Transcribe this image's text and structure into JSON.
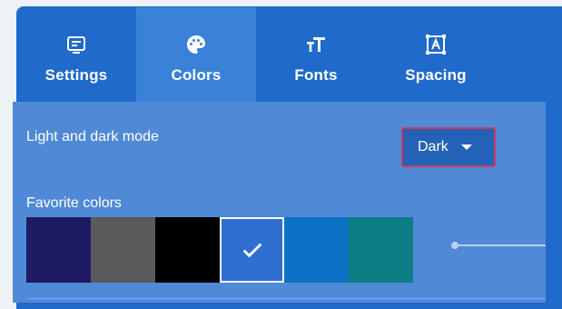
{
  "tabs": [
    {
      "label": "Settings",
      "icon": "settings-icon",
      "active": false
    },
    {
      "label": "Colors",
      "icon": "palette-icon",
      "active": true
    },
    {
      "label": "Fonts",
      "icon": "text-size-icon",
      "active": false
    },
    {
      "label": "Spacing",
      "icon": "spacing-icon",
      "active": false
    }
  ],
  "mode": {
    "label": "Light and dark mode",
    "value": "Dark"
  },
  "favorites": {
    "label": "Favorite colors",
    "swatches": [
      {
        "color": "#1c1b63",
        "selected": false
      },
      {
        "color": "#5a5a5a",
        "selected": false
      },
      {
        "color": "#000000",
        "selected": false
      },
      {
        "color": "#2f6fd2",
        "selected": true
      },
      {
        "color": "#0b73c3",
        "selected": false
      },
      {
        "color": "#0b7f85",
        "selected": false
      }
    ]
  },
  "colors": {
    "panel": "#1f6acb",
    "tab_active": "#3a81d8",
    "content": "#5089d6",
    "dropdown_border": "#c93a5e"
  }
}
